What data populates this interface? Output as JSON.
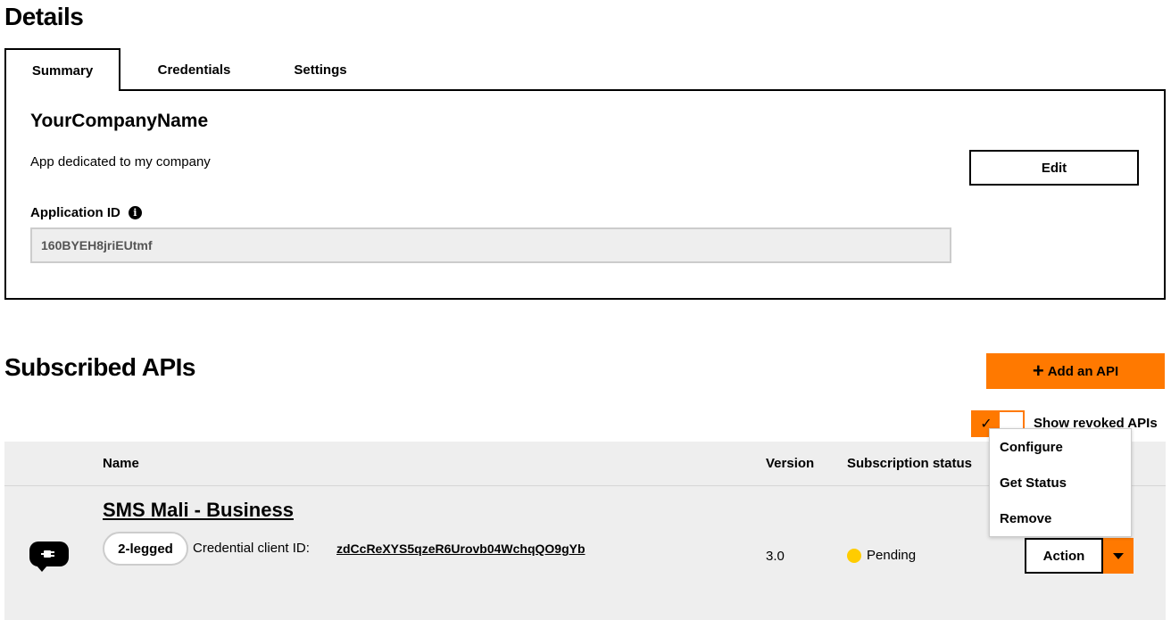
{
  "details": {
    "title": "Details"
  },
  "tabs": [
    {
      "label": "Summary",
      "active": true
    },
    {
      "label": "Credentials",
      "active": false
    },
    {
      "label": "Settings",
      "active": false
    }
  ],
  "summary": {
    "app_name": "YourCompanyName",
    "description": "App dedicated to my company",
    "edit_label": "Edit",
    "app_id_label": "Application ID",
    "app_id_value": "160BYEH8jriEUtmf",
    "info_icon": "info-icon"
  },
  "subscribed": {
    "title": "Subscribed APIs",
    "add_label": "Add an API",
    "show_revoked_label": "Show revoked APIs",
    "show_revoked_checked": true
  },
  "table": {
    "headers": {
      "name": "Name",
      "version": "Version",
      "status": "Subscription status"
    },
    "rows": [
      {
        "name": "SMS Mali - Business",
        "auth_type": "2-legged",
        "cred_label": "Credential client ID:",
        "cred_id": "zdCcReXYS5qzeR6Urovb04WchqQO9gYb",
        "version": "3.0",
        "status": "Pending",
        "status_color": "#ffcc00",
        "action_label": "Action"
      }
    ]
  },
  "action_menu": {
    "items": [
      "Configure",
      "Get Status",
      "Remove"
    ]
  },
  "colors": {
    "accent": "#ff7900",
    "pending": "#ffcc00",
    "table_bg": "#eeeeee"
  }
}
